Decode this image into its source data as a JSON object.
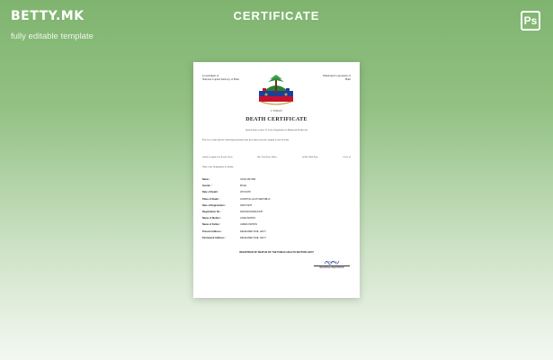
{
  "brand": {
    "logo": "BETTY.MK",
    "tagline": "fully editable template"
  },
  "header": {
    "title": "CERTIFICATE",
    "ps_badge": "Ps"
  },
  "certificate": {
    "left_header": [
      "Government of",
      "National Capital Territory of Haiti"
    ],
    "right_header": [
      "Municipal Corporation of",
      "Haiti"
    ],
    "motto": "L'UNION",
    "title": "DEATH CERTIFICATE",
    "intro": "(Issued under section 12 of the Registration of Births and Deaths act)",
    "certify": "This is to certify that the following information has been taken from the original record of death",
    "which_row": [
      "which is register for (Local Area)",
      "Ms. Tech Zone Office",
      "of Ms. Haiti Zone",
      "Govt. of"
    ],
    "reg_row": "Haiti of the Registration of Deaths",
    "fields": [
      {
        "label": "Name :",
        "value": "JOHN PETRIN"
      },
      {
        "label": "Gender :",
        "value": "MALE"
      },
      {
        "label": "Date of Death :",
        "value": "25/7/1978"
      },
      {
        "label": "Place of Death :",
        "value": "HOSPITAL HAITI REPUBLIC"
      },
      {
        "label": "Date of Registration :",
        "value": "30/07/1978"
      },
      {
        "label": "Registration No :",
        "value": "D/001/001/0001/1978"
      },
      {
        "label": "Name of Mother :",
        "value": "JANE PETRIN"
      },
      {
        "label": "Name of Father :",
        "value": "JAMES PETRIN"
      },
      {
        "label": "Present Address :",
        "value": "DECEASED RUE, HAITI"
      },
      {
        "label": "Permanent Address :",
        "value": "DECEASED RUE, HAITI"
      }
    ],
    "registrar": "REGISTRAR OF DEATHS OF THE PUBLIC HEALTH SECTION HAITI",
    "signature": "J.Zulinio",
    "signature_label": "REGIONAL REGISTRAR"
  }
}
